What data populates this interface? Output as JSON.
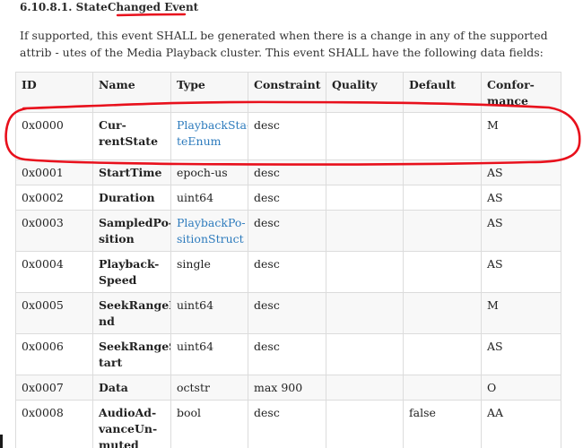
{
  "section": {
    "number": "6.10.8.1.",
    "title_plain": "StateChanged",
    "title_emph": "Event"
  },
  "intro_text": "If supported, this event SHALL be generated when there is a change in any of the supported attrib - utes of the Media Playback cluster. This event SHALL have the following data fields:",
  "table": {
    "headers": [
      "ID",
      "Name",
      "Type",
      "Constraint",
      "Quality",
      "Default",
      "Confor-mance"
    ],
    "rows": [
      {
        "id": "0x0000",
        "name": "Cur-rentState",
        "type": "PlaybackSta-teEnum",
        "constraint": "desc",
        "quality": "",
        "default": "",
        "conformance": "M"
      },
      {
        "id": "0x0001",
        "name": "StartTime",
        "type": "epoch-us",
        "constraint": "desc",
        "quality": "",
        "default": "",
        "conformance": "AS"
      },
      {
        "id": "0x0002",
        "name": "Duration",
        "type": "uint64",
        "constraint": "desc",
        "quality": "",
        "default": "",
        "conformance": "AS"
      },
      {
        "id": "0x0003",
        "name": "SampledPo-sition",
        "type": "PlaybackPo-sitionStruct",
        "constraint": "desc",
        "quality": "",
        "default": "",
        "conformance": "AS"
      },
      {
        "id": "0x0004",
        "name": "Playback-Speed",
        "type": "single",
        "constraint": "desc",
        "quality": "",
        "default": "",
        "conformance": "AS"
      },
      {
        "id": "0x0005",
        "name": "SeekRangeE-nd",
        "type": "uint64",
        "constraint": "desc",
        "quality": "",
        "default": "",
        "conformance": "M"
      },
      {
        "id": "0x0006",
        "name": "SeekRangeS-tart",
        "type": "uint64",
        "constraint": "desc",
        "quality": "",
        "default": "",
        "conformance": "AS"
      },
      {
        "id": "0x0007",
        "name": "Data",
        "type": "octstr",
        "constraint": "max 900",
        "quality": "",
        "default": "",
        "conformance": "O"
      },
      {
        "id": "0x0008",
        "name": "AudioAd-vanceUn-muted",
        "type": "bool",
        "constraint": "desc",
        "quality": "",
        "default": "false",
        "conformance": "AA"
      }
    ]
  },
  "annotation_color": "#e8101c",
  "link_color": "#2d7bbd"
}
